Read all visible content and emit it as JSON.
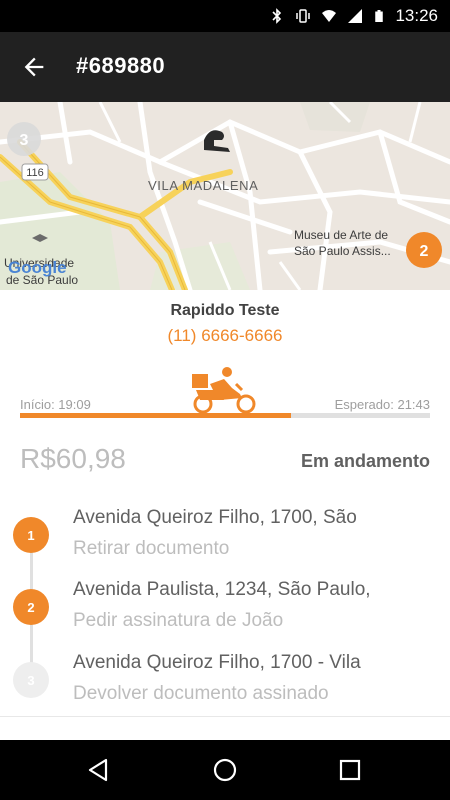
{
  "status_bar": {
    "time": "13:26",
    "icons": [
      "bluetooth-icon",
      "vibrate-icon",
      "wifi-icon",
      "signal-icon",
      "battery-icon"
    ]
  },
  "app_bar": {
    "title": "#689880",
    "back_icon": "arrow-left-icon"
  },
  "map": {
    "labels": {
      "highway": "116",
      "district": "VILA MADALENA",
      "museum_line1": "Museu de Arte de",
      "museum_line2": "São Paulo Assis...",
      "university_line1": "Universidade",
      "university_line2": "de São Paulo",
      "brand": "Google"
    },
    "markers": [
      {
        "label": "3",
        "state": "inactive"
      },
      {
        "label": "2",
        "state": "active"
      }
    ]
  },
  "contact": {
    "name": "Rapiddo Teste",
    "phone": "(11) 6666-6666"
  },
  "timeline": {
    "start_label": "Início: 19:09",
    "end_label": "Esperado: 21:43",
    "progress_fraction": 0.66
  },
  "order": {
    "price": "R$60,98",
    "status": "Em andamento"
  },
  "stops": [
    {
      "number": "1",
      "address": "Avenida Queiroz Filho, 1700, São",
      "task": "Retirar documento",
      "state": "active"
    },
    {
      "number": "2",
      "address": "Avenida Paulista, 1234, São Paulo,",
      "task": "Pedir assinatura de João",
      "state": "active"
    },
    {
      "number": "3",
      "address": "Avenida Queiroz Filho, 1700 - Vila",
      "task": "Devolver documento assinado",
      "state": "inactive"
    }
  ],
  "colors": {
    "accent": "#f0882a",
    "appbar": "#212121",
    "inactive": "#eeeeee"
  }
}
